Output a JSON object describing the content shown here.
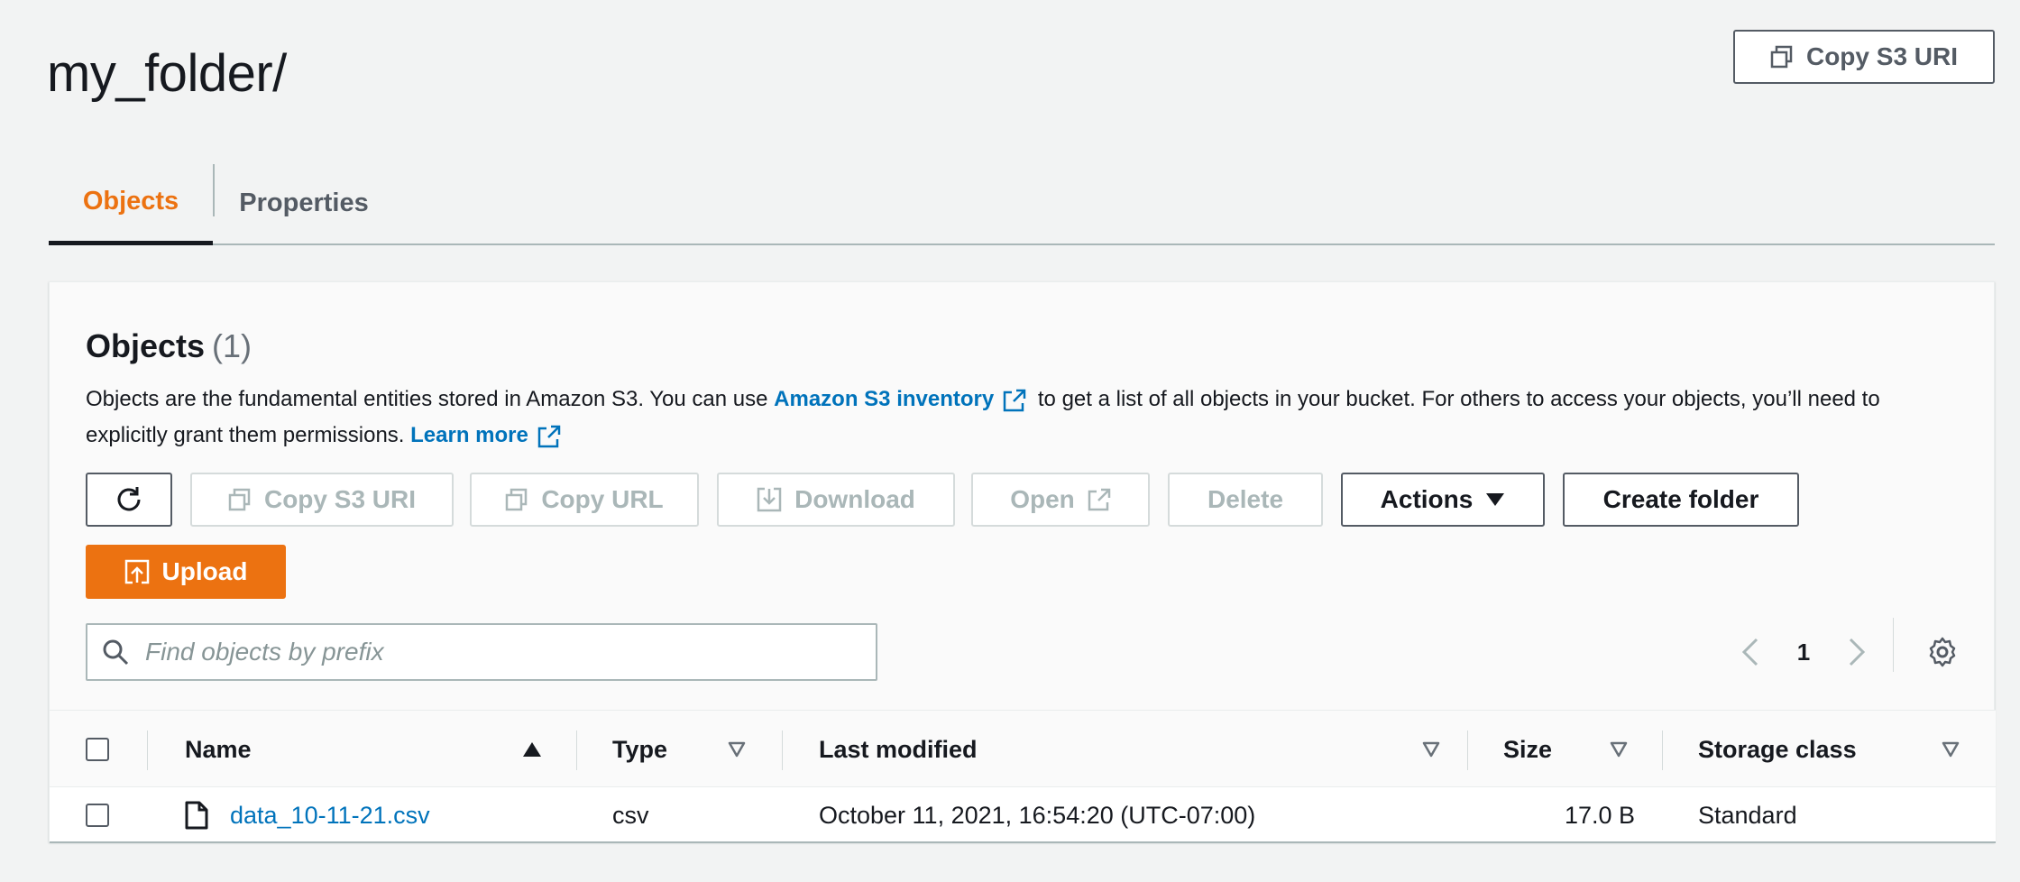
{
  "page": {
    "title": "my_folder/",
    "copy_s3_uri_label": "Copy S3 URI"
  },
  "tabs": [
    {
      "label": "Objects",
      "active": true
    },
    {
      "label": "Properties",
      "active": false
    }
  ],
  "objects_panel": {
    "title": "Objects",
    "count": "(1)",
    "description": {
      "part1": "Objects are the fundamental entities stored in Amazon S3. You can use ",
      "link1": "Amazon S3 inventory",
      "part2": " to get a list of all objects in your bucket. For others to access your objects, you’ll need to explicitly grant them permissions. ",
      "link2": "Learn more"
    },
    "toolbar": {
      "refresh_icon": "refresh-icon",
      "copy_s3_uri": "Copy S3 URI",
      "copy_url": "Copy URL",
      "download": "Download",
      "open": "Open",
      "delete": "Delete",
      "actions": "Actions",
      "create_folder": "Create folder",
      "upload": "Upload"
    },
    "search": {
      "placeholder": "Find objects by prefix",
      "value": ""
    },
    "pagination": {
      "current_page": "1"
    },
    "table": {
      "columns": [
        "Name",
        "Type",
        "Last modified",
        "Size",
        "Storage class"
      ],
      "rows": [
        {
          "name": "data_10-11-21.csv",
          "type": "csv",
          "last_modified": "October 11, 2021, 16:54:20 (UTC-07:00)",
          "size": "17.0 B",
          "storage_class": "Standard"
        }
      ]
    }
  },
  "colors": {
    "accent": "#ec7211",
    "link": "#0073bb",
    "background": "#f2f3f3",
    "disabled": "#aab7b8"
  }
}
